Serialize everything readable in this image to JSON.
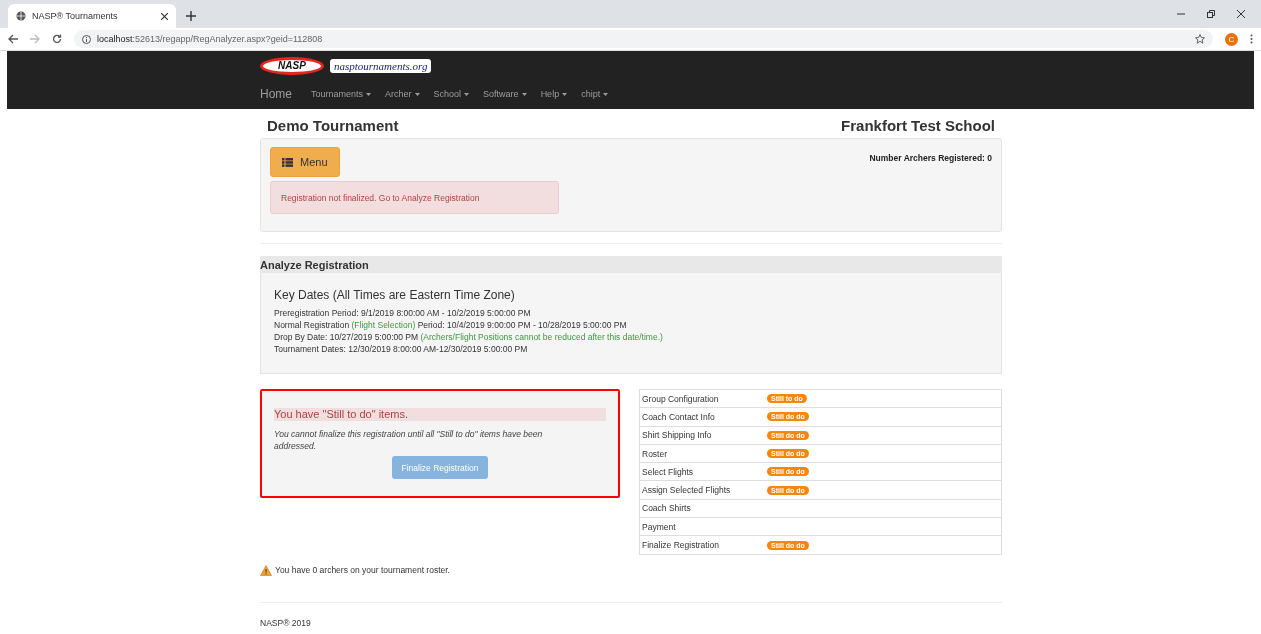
{
  "browser": {
    "tab_title": "NASP® Tournaments",
    "url_host": "localhost",
    "url_rest": ":52613/regapp/RegAnalyzer.aspx?geid=112808",
    "avatar": "C"
  },
  "navbar": {
    "logo": "NASP",
    "site": "nasptournaments.org",
    "items": [
      {
        "label": "Home",
        "dropdown": false
      },
      {
        "label": "Tournaments",
        "dropdown": true
      },
      {
        "label": "Archer",
        "dropdown": true
      },
      {
        "label": "School",
        "dropdown": true
      },
      {
        "label": "Software",
        "dropdown": true
      },
      {
        "label": "Help",
        "dropdown": true
      },
      {
        "label": "chipt",
        "dropdown": true
      }
    ]
  },
  "header": {
    "tournament": "Demo Tournament",
    "school": "Frankfort Test School"
  },
  "top_panel": {
    "menu_button": "Menu",
    "archers_registered": "Number Archers Registered: 0",
    "alert": "Registration not finalized. Go to Analyze Registration"
  },
  "analyze": {
    "title": "Analyze Registration",
    "key_dates_title": "Key Dates (All Times are Eastern Time Zone)",
    "lines": [
      [
        {
          "kind": "plain",
          "text": "Preregistration Period: 9/1/2019 8:00:00 AM - 10/2/2019 5:00:00 PM"
        }
      ],
      [
        {
          "kind": "plain",
          "text": "Normal Registration "
        },
        {
          "kind": "note",
          "text": "(Flight Selection)"
        },
        {
          "kind": "plain",
          "text": " Period: 10/4/2019 9:00:00 PM - 10/28/2019 5:00:00 PM"
        }
      ],
      [
        {
          "kind": "plain",
          "text": "Drop By Date: 10/27/2019 5:00:00 PM "
        },
        {
          "kind": "note",
          "text": "(Archers/Flight Positions cannot be reduced after this date/time.)"
        }
      ],
      [
        {
          "kind": "plain",
          "text": "Tournament Dates: 12/30/2019 8:00:00 AM-12/30/2019 5:00:00 PM"
        }
      ]
    ]
  },
  "finalize": {
    "heading": "You have \"Still to do\" items.",
    "message": "You cannot finalize this registration until all \"Still to do\" items have been addressed.",
    "button": "Finalize Registration",
    "disabled": true
  },
  "checklist": [
    {
      "label": "Group Configuration",
      "badge": "Still to do"
    },
    {
      "label": "Coach Contact Info",
      "badge": "Still do do"
    },
    {
      "label": "Shirt Shipping Info",
      "badge": "Still do do"
    },
    {
      "label": "Roster",
      "badge": "Still do do"
    },
    {
      "label": "Select Flights",
      "badge": "Still do do"
    },
    {
      "label": "Assign Selected Flights",
      "badge": "Still do do"
    },
    {
      "label": "Coach Shirts"
    },
    {
      "label": "Payment"
    },
    {
      "label": "Finalize Registration",
      "badge": "Still do do"
    }
  ],
  "roster_warning": "You have 0 archers on your tournament roster.",
  "footer": "NASP® 2019"
}
